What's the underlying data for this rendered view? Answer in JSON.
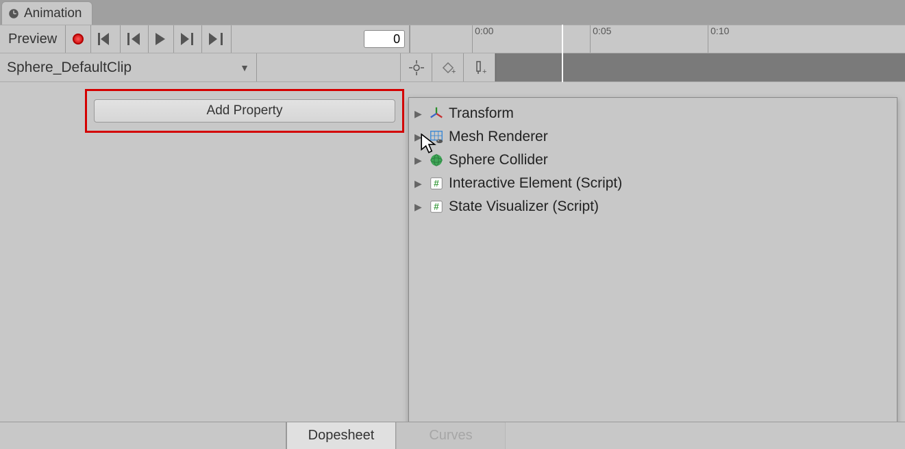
{
  "tab": {
    "label": "Animation"
  },
  "toolbar": {
    "preview_label": "Preview",
    "frame_value": "0",
    "ticks": [
      "0:00",
      "0:05",
      "0:10"
    ]
  },
  "clip": {
    "name": "Sphere_DefaultClip"
  },
  "add_property_label": "Add Property",
  "popup": {
    "items": [
      {
        "label": "Transform",
        "icon": "transform"
      },
      {
        "label": "Mesh Renderer",
        "icon": "mesh"
      },
      {
        "label": "Sphere Collider",
        "icon": "collider"
      },
      {
        "label": "Interactive Element (Script)",
        "icon": "script"
      },
      {
        "label": "State Visualizer (Script)",
        "icon": "script"
      }
    ]
  },
  "bottom": {
    "dopesheet_label": "Dopesheet",
    "curves_label": "Curves"
  }
}
